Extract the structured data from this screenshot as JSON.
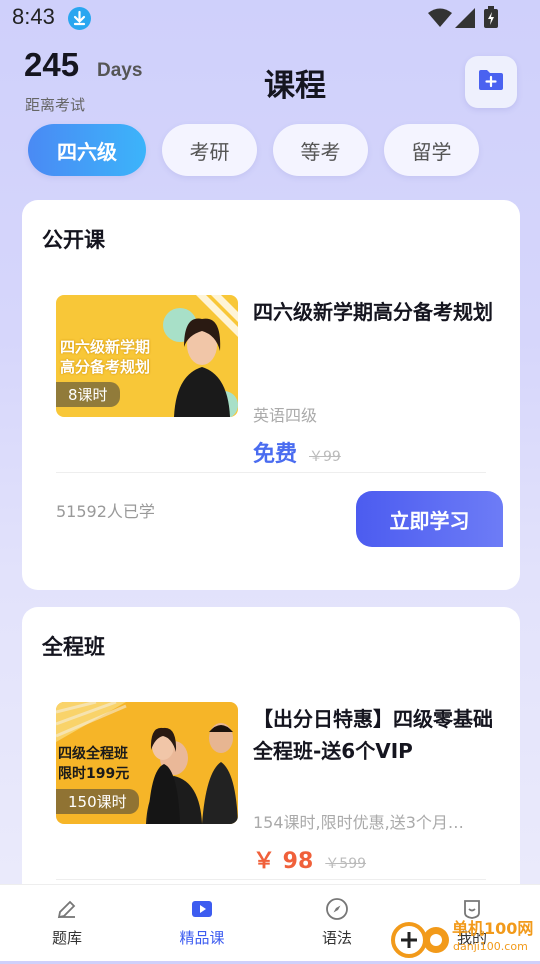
{
  "status": {
    "time": "8:43"
  },
  "header": {
    "days_count": "245",
    "days_unit": "Days",
    "days_label": "距离考试",
    "title": "课程"
  },
  "tabs": [
    {
      "label": "四六级",
      "active": true
    },
    {
      "label": "考研",
      "active": false
    },
    {
      "label": "等考",
      "active": false
    },
    {
      "label": "留学",
      "active": false
    }
  ],
  "sections": [
    {
      "title": "公开课",
      "course": {
        "thumb_text_line1": "四六级新学期",
        "thumb_text_line2": "高分备考规划",
        "badge": "8课时",
        "title": "四六级新学期高分备考规划",
        "subtitle": "英语四级",
        "price": "免费",
        "original_price": "￥99",
        "learners": "51592人已学",
        "button": "立即学习"
      }
    },
    {
      "title": "全程班",
      "course": {
        "thumb_text_line1": "四级全程班",
        "thumb_text_line2": "限时199元",
        "badge": "150课时",
        "title": "【出分日特惠】四级零基础全程班-送6个VIP",
        "subtitle": "154课时,限时优惠,送3个月…",
        "price": "￥ 98",
        "original_price": "￥599"
      }
    }
  ],
  "nav": [
    {
      "label": "题库",
      "icon": "pencil-icon",
      "active": false
    },
    {
      "label": "精品课",
      "icon": "video-icon",
      "active": true
    },
    {
      "label": "语法",
      "icon": "compass-icon",
      "active": false
    },
    {
      "label": "我的",
      "icon": "profile-icon",
      "active": false
    }
  ],
  "watermark": {
    "text": "单机100网",
    "url_text": "danji100.com"
  },
  "colors": {
    "primary": "#4c5cf0",
    "tab_active": "#4a8af4",
    "price_red": "#f0603a",
    "nav_active": "#3d5cf0"
  }
}
